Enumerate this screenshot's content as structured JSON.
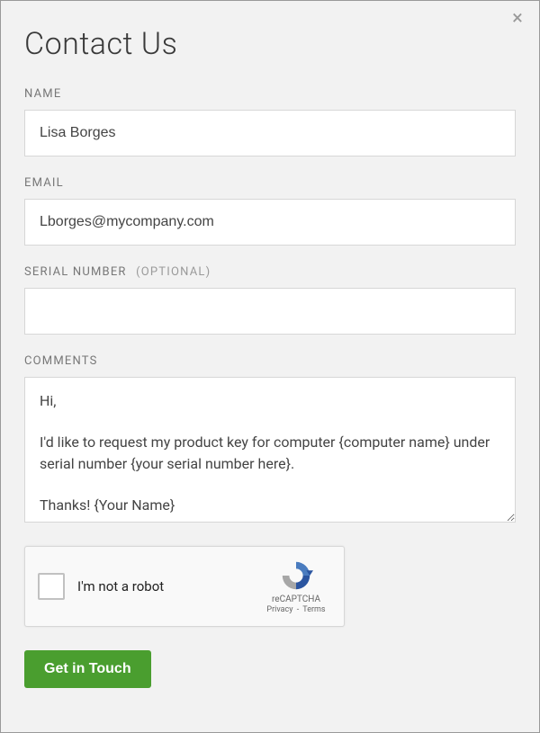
{
  "title": "Contact Us",
  "fields": {
    "name": {
      "label": "NAME",
      "value": "Lisa Borges"
    },
    "email": {
      "label": "EMAIL",
      "value": "Lborges@mycompany.com"
    },
    "serial": {
      "label": "SERIAL NUMBER",
      "optional": "(OPTIONAL)",
      "value": ""
    },
    "comments": {
      "label": "COMMENTS",
      "value": "Hi,\n\nI'd like to request my product key for computer {computer name} under serial number {your serial number here}.\n\nThanks! {Your Name}"
    }
  },
  "recaptcha": {
    "label": "I'm not a robot",
    "brand": "reCAPTCHA",
    "privacy": "Privacy",
    "terms": "Terms"
  },
  "submit_label": "Get in Touch"
}
